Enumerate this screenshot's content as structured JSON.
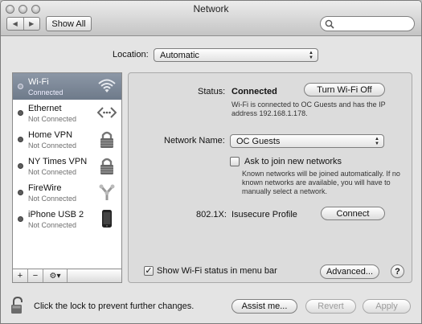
{
  "window": {
    "title": "Network",
    "nav_back": "◀",
    "nav_forward": "▶",
    "show_all": "Show All",
    "search_placeholder": ""
  },
  "location": {
    "label": "Location:",
    "value": "Automatic"
  },
  "services": [
    {
      "name": "Wi-Fi",
      "status": "Connected",
      "icon": "wifi-icon",
      "selected": true
    },
    {
      "name": "Ethernet",
      "status": "Not Connected",
      "icon": "ethernet-icon",
      "selected": false
    },
    {
      "name": "Home VPN",
      "status": "Not Connected",
      "icon": "vpn-lock-icon",
      "selected": false
    },
    {
      "name": "NY Times VPN",
      "status": "Not Connected",
      "icon": "vpn-lock-icon",
      "selected": false
    },
    {
      "name": "FireWire",
      "status": "Not Connected",
      "icon": "firewire-icon",
      "selected": false
    },
    {
      "name": "iPhone USB 2",
      "status": "Not Connected",
      "icon": "iphone-icon",
      "selected": false
    }
  ],
  "list_toolbar": {
    "add": "+",
    "remove": "−",
    "gear": "⚙▾"
  },
  "detail": {
    "status_label": "Status:",
    "status_value": "Connected",
    "toggle_button": "Turn Wi-Fi Off",
    "status_desc": "Wi-Fi is connected to OC Guests and has the IP address 192.168.1.178.",
    "network_name_label": "Network Name:",
    "network_name_value": "OC Guests",
    "ask_join_label": "Ask to join new networks",
    "ask_join_checked": false,
    "ask_join_desc": "Known networks will be joined automatically. If no known networks are available, you will have to manually select a network.",
    "dot1x_label": "802.1X:",
    "dot1x_value": "Isusecure Profile",
    "connect_button": "Connect",
    "show_status_label": "Show Wi-Fi status in menu bar",
    "show_status_checked": true,
    "advanced_button": "Advanced...",
    "help": "?"
  },
  "footer": {
    "lock_text": "Click the lock to prevent further changes.",
    "assist_button": "Assist me...",
    "revert_button": "Revert",
    "apply_button": "Apply"
  }
}
